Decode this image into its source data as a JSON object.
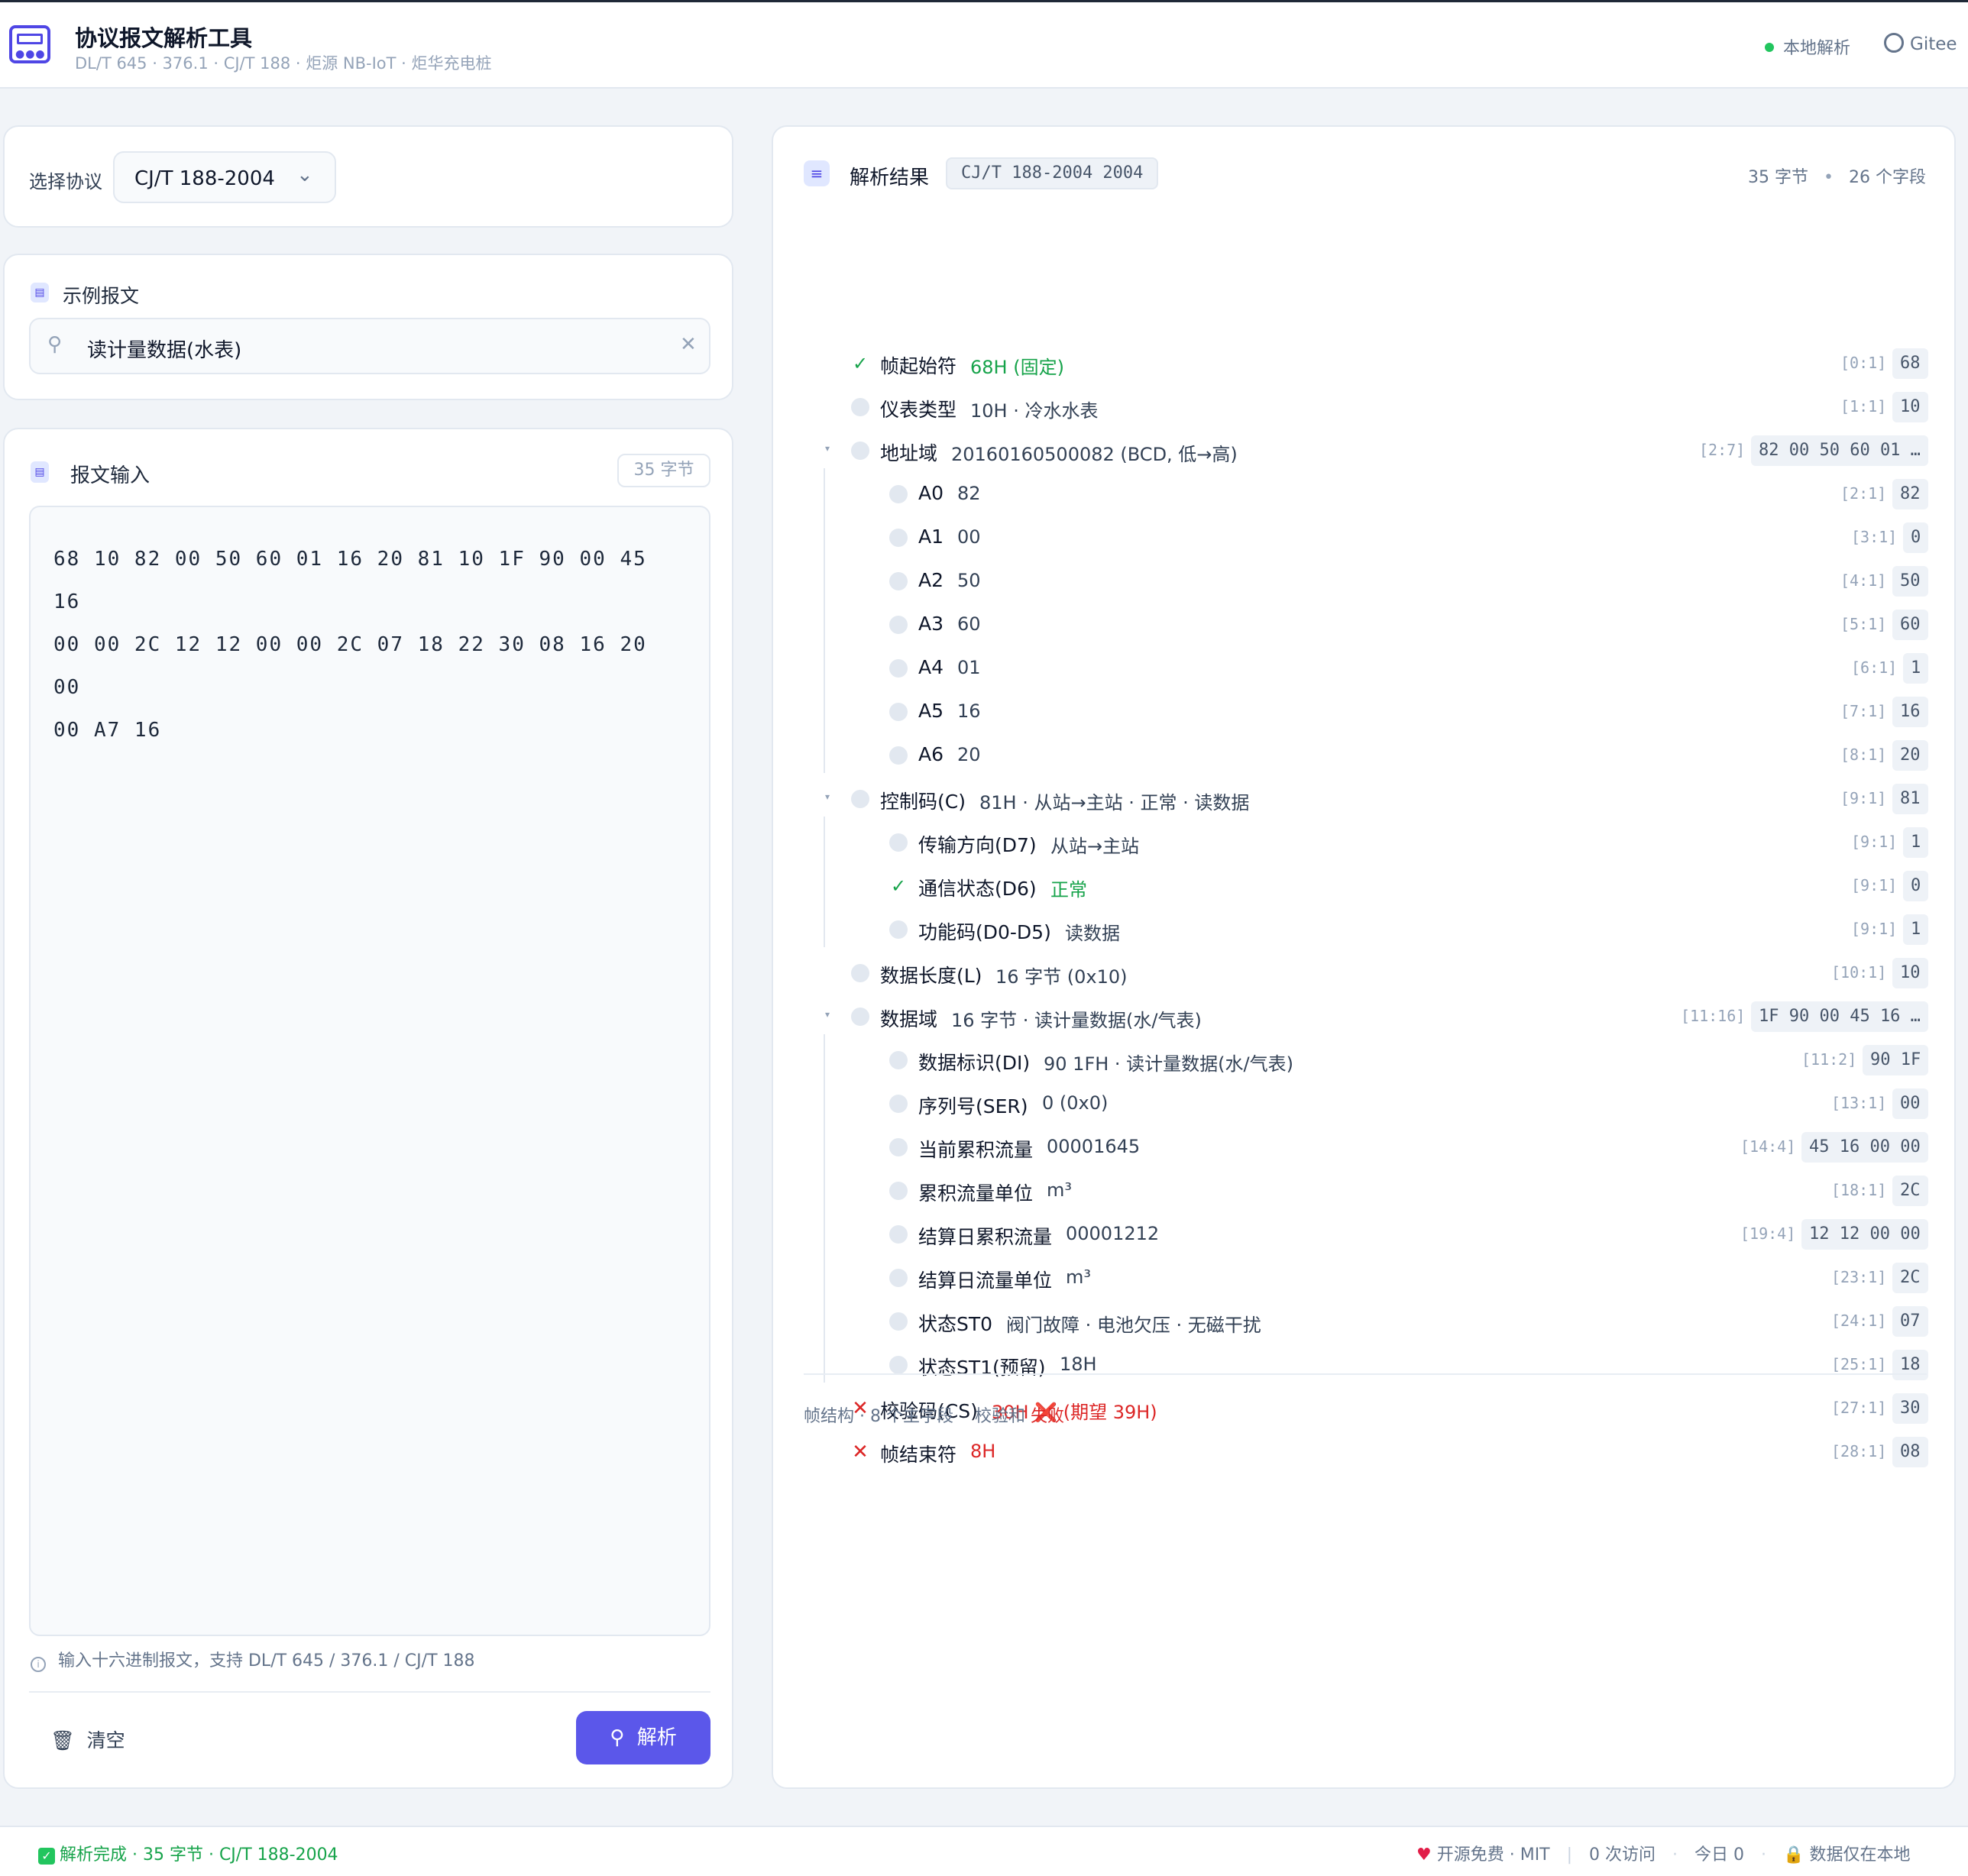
{
  "header": {
    "title": "协议报文解析工具",
    "subtitle": "DL/T 645 · 376.1 · CJ/T 188 · 炬源 NB-IoT · 炬华充电桩",
    "status": "本地解析",
    "gitee": "Gitee"
  },
  "protocol": {
    "label": "选择协议",
    "value": "CJ/T 188-2004"
  },
  "example": {
    "title": "示例报文",
    "value": "读计量数据(水表)"
  },
  "input": {
    "title": "报文输入",
    "bytes_badge": "35 字节",
    "hex_lines": [
      "68 10 82 00 50 60 01 16 20 81 10 1F 90 00 45 16",
      "00 00 2C 12 12 00 00 2C 07 18 22 30 08 16 20 00",
      "00 A7 16"
    ],
    "hint": "输入十六进制报文，支持 DL/T 645 / 376.1 / CJ/T 188",
    "clear_label": "清空",
    "parse_label": "解析"
  },
  "result": {
    "title": "解析结果",
    "badge": "CJ/T 188-2004 2004",
    "bytes": "35 字节",
    "fields": "26 个字段",
    "footer_struct": "帧结构 · 8 个主字段",
    "footer_cs_label": "校验和",
    "footer_cs_value": "失败",
    "rows": [
      {
        "name": "帧起始符",
        "value": "68H (固定)",
        "pos": "[0:1]",
        "hex": "68",
        "level": 0,
        "icon": "ok",
        "vcolor": "green"
      },
      {
        "name": "仪表类型",
        "value": "10H · 冷水水表",
        "pos": "[1:1]",
        "hex": "10",
        "level": 0,
        "icon": "dot"
      },
      {
        "name": "地址域",
        "value": "20160160500082 (BCD, 低→高)",
        "pos": "[2:7]",
        "hex": "82 00 50 60 01 …",
        "level": 0,
        "icon": "dot",
        "toggle": true
      },
      {
        "name": "A0",
        "value": "82",
        "pos": "[2:1]",
        "hex": "82",
        "level": 1,
        "icon": "dot"
      },
      {
        "name": "A1",
        "value": "00",
        "pos": "[3:1]",
        "hex": "0",
        "level": 1,
        "icon": "dot"
      },
      {
        "name": "A2",
        "value": "50",
        "pos": "[4:1]",
        "hex": "50",
        "level": 1,
        "icon": "dot"
      },
      {
        "name": "A3",
        "value": "60",
        "pos": "[5:1]",
        "hex": "60",
        "level": 1,
        "icon": "dot"
      },
      {
        "name": "A4",
        "value": "01",
        "pos": "[6:1]",
        "hex": "1",
        "level": 1,
        "icon": "dot"
      },
      {
        "name": "A5",
        "value": "16",
        "pos": "[7:1]",
        "hex": "16",
        "level": 1,
        "icon": "dot"
      },
      {
        "name": "A6",
        "value": "20",
        "pos": "[8:1]",
        "hex": "20",
        "level": 1,
        "icon": "dot"
      },
      {
        "name": "控制码(C)",
        "value": "81H · 从站→主站 · 正常 · 读数据",
        "pos": "[9:1]",
        "hex": "81",
        "level": 0,
        "icon": "dot",
        "toggle": true
      },
      {
        "name": "传输方向(D7)",
        "value": "从站→主站",
        "pos": "[9:1]",
        "hex": "1",
        "level": 1,
        "icon": "dot"
      },
      {
        "name": "通信状态(D6)",
        "value": "正常",
        "pos": "[9:1]",
        "hex": "0",
        "level": 1,
        "icon": "ok",
        "vcolor": "green"
      },
      {
        "name": "功能码(D0-D5)",
        "value": "读数据",
        "pos": "[9:1]",
        "hex": "1",
        "level": 1,
        "icon": "dot"
      },
      {
        "name": "数据长度(L)",
        "value": "16 字节 (0x10)",
        "pos": "[10:1]",
        "hex": "10",
        "level": 0,
        "icon": "dot"
      },
      {
        "name": "数据域",
        "value": "16 字节 · 读计量数据(水/气表)",
        "pos": "[11:16]",
        "hex": "1F 90 00 45 16 …",
        "level": 0,
        "icon": "dot",
        "toggle": true
      },
      {
        "name": "数据标识(DI)",
        "value": "90 1FH · 读计量数据(水/气表)",
        "pos": "[11:2]",
        "hex": "90 1F",
        "level": 1,
        "icon": "dot"
      },
      {
        "name": "序列号(SER)",
        "value": "0 (0x0)",
        "pos": "[13:1]",
        "hex": "00",
        "level": 1,
        "icon": "dot"
      },
      {
        "name": "当前累积流量",
        "value": "00001645",
        "pos": "[14:4]",
        "hex": "45 16 00 00",
        "level": 1,
        "icon": "dot"
      },
      {
        "name": "累积流量单位",
        "value": "m³",
        "pos": "[18:1]",
        "hex": "2C",
        "level": 1,
        "icon": "dot"
      },
      {
        "name": "结算日累积流量",
        "value": "00001212",
        "pos": "[19:4]",
        "hex": "12 12 00 00",
        "level": 1,
        "icon": "dot"
      },
      {
        "name": "结算日流量单位",
        "value": "m³",
        "pos": "[23:1]",
        "hex": "2C",
        "level": 1,
        "icon": "dot"
      },
      {
        "name": "状态ST0",
        "value": "阀门故障 · 电池欠压 · 无磁干扰",
        "pos": "[24:1]",
        "hex": "07",
        "level": 1,
        "icon": "dot"
      },
      {
        "name": "状态ST1(预留)",
        "value": "18H",
        "pos": "[25:1]",
        "hex": "18",
        "level": 1,
        "icon": "dot"
      },
      {
        "name": "校验码(CS)",
        "value": "30H ❌ (期望 39H)",
        "pos": "[27:1]",
        "hex": "30",
        "level": 0,
        "icon": "err",
        "vcolor": "red"
      },
      {
        "name": "帧结束符",
        "value": "8H",
        "pos": "[28:1]",
        "hex": "08",
        "level": 0,
        "icon": "err",
        "vcolor": "red"
      }
    ]
  },
  "footer": {
    "status": "解析完成 · 35 字节 · CJ/T 188-2004",
    "opensource": "开源免费 · MIT",
    "visits": "0 次访问",
    "today": "今日 0",
    "local": "数据仅在本地"
  }
}
